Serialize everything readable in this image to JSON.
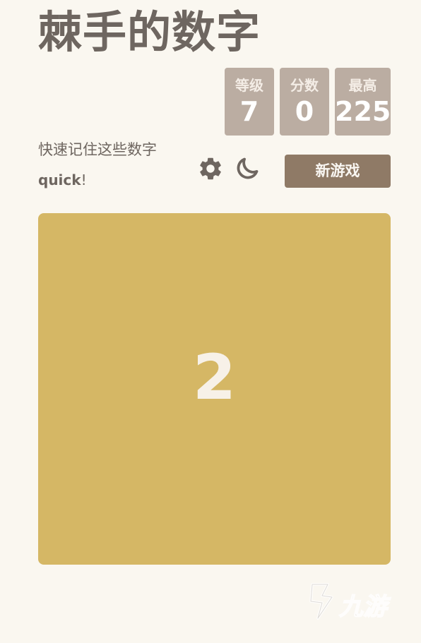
{
  "header": {
    "title": "棘手的数字"
  },
  "scores": {
    "level_label": "等级",
    "level_value": "7",
    "score_label": "分数",
    "score_value": "0",
    "best_label": "最高",
    "best_value": "225"
  },
  "intro": {
    "line1": "快速记住这些数字",
    "line2_bold": "quick",
    "line2_rest": "!"
  },
  "controls": {
    "settings_icon": "gear-icon",
    "theme_icon": "moon-icon",
    "new_game_label": "新游戏"
  },
  "board": {
    "tile_value": "2",
    "tile_color": "#d5b765"
  },
  "watermark": {
    "text": "九游"
  },
  "colors": {
    "background": "#faf7f0",
    "score_box": "#bbada2",
    "button": "#8f7a66",
    "text": "#6e6660"
  }
}
